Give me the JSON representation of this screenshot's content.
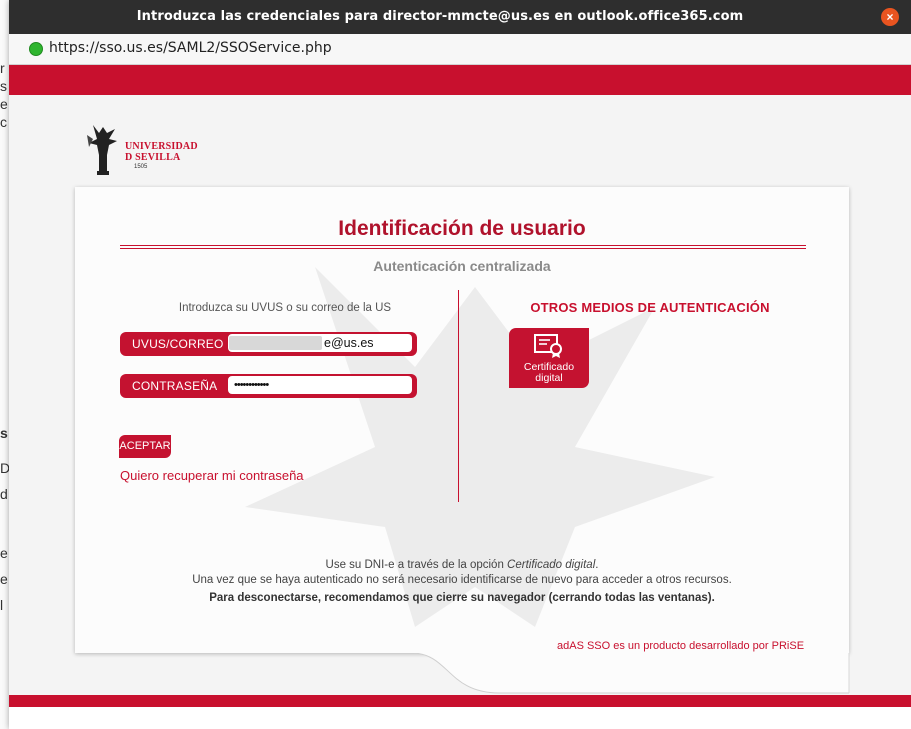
{
  "window": {
    "title": "Introduzca las credenciales para director-mmcte@us.es en outlook.office365.com",
    "close_glyph": "×",
    "url": "https://sso.us.es/SAML2/SSOService.php"
  },
  "background_glyphs": [
    "r",
    "s",
    "e",
    "c",
    "s",
    "D",
    "d",
    "e",
    "e",
    "l"
  ],
  "logo": {
    "line1": "UNIVERSIDAD",
    "line2": "D SEVILLA",
    "year": "1505"
  },
  "login": {
    "heading": "Identificación de usuario",
    "subheading": "Autenticación centralizada",
    "intro": "Introduzca su UVUS o su correo de la US",
    "user_label": "UVUS/CORREO",
    "user_value": "e@us.es",
    "password_label": "CONTRASEÑA",
    "password_value": "••••••••••••",
    "submit_label": "ACEPTAR",
    "recover_link": "Quiero recuperar mi contraseña"
  },
  "other_methods": {
    "heading": "OTROS MEDIOS DE AUTENTICACIÓN",
    "cert_label_1": "Certificado",
    "cert_label_2": "digital"
  },
  "footer": {
    "line1_prefix": "Use su DNI-e a través de la opción ",
    "line1_emphasis": "Certificado digital",
    "line1_suffix": ".",
    "line2": "Una vez que se haya autenticado no será necesario identificarse de nuevo para acceder a otros recursos.",
    "line3": "Para desconectarse, recomendamos que cierre su navegador (cerrando todas las ventanas).",
    "credit": "adAS SSO es un producto desarrollado por PRiSE"
  },
  "colors": {
    "brand_red": "#c8102e",
    "title_bar": "#2e2e2e",
    "close_button": "#e95420",
    "secure_dot": "#2fb52f"
  }
}
